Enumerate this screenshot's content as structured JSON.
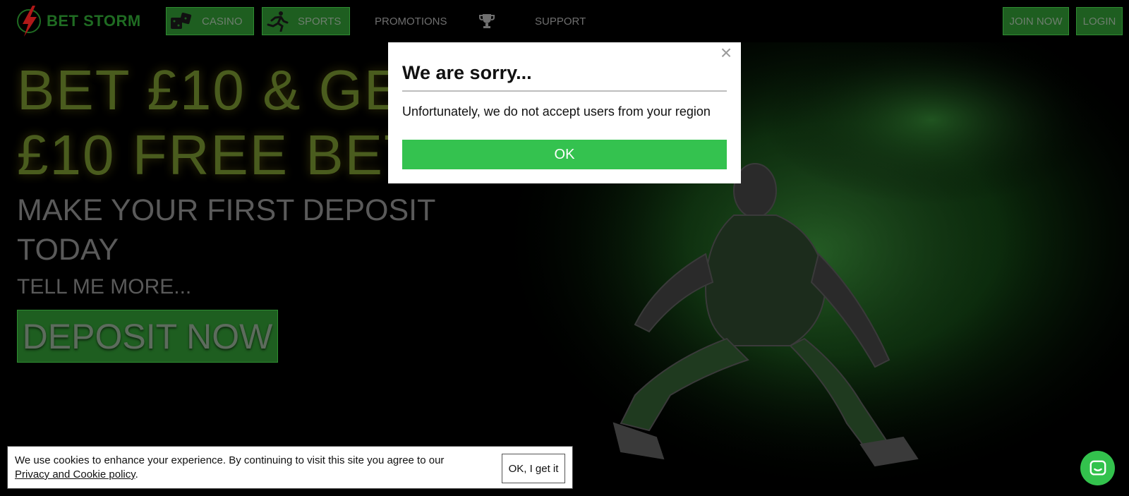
{
  "brand": {
    "name": "BET STORM",
    "logo_icon": "lightning-bolt-icon",
    "accent_color": "#34c24f",
    "nav_green": "#1e5e20"
  },
  "nav": {
    "casino_label": "CASINO",
    "sports_label": "SPORTS",
    "promotions_label": "PROMOTIONS",
    "trophy_icon": "trophy-icon",
    "support_label": "SUPPORT",
    "join_label": "JOIN NOW",
    "login_label": "LOGIN"
  },
  "hero": {
    "title": "BET £10 & GET\n£10 FREE BET",
    "subtitle": "MAKE YOUR FIRST DEPOSIT TODAY",
    "more": "TELL ME MORE...",
    "deposit_label": "DEPOSIT NOW"
  },
  "modal": {
    "title": "We are sorry...",
    "message": "Unfortunately, we do not accept users from your region",
    "ok_label": "OK",
    "close_icon": "close-icon"
  },
  "cookie": {
    "text": "We use cookies to enhance your experience. By continuing to visit this site you agree to our",
    "link_label": "Privacy and Cookie policy",
    "link_suffix": ".",
    "accept_label": "OK, I get it"
  },
  "chat": {
    "icon": "chat-icon"
  }
}
